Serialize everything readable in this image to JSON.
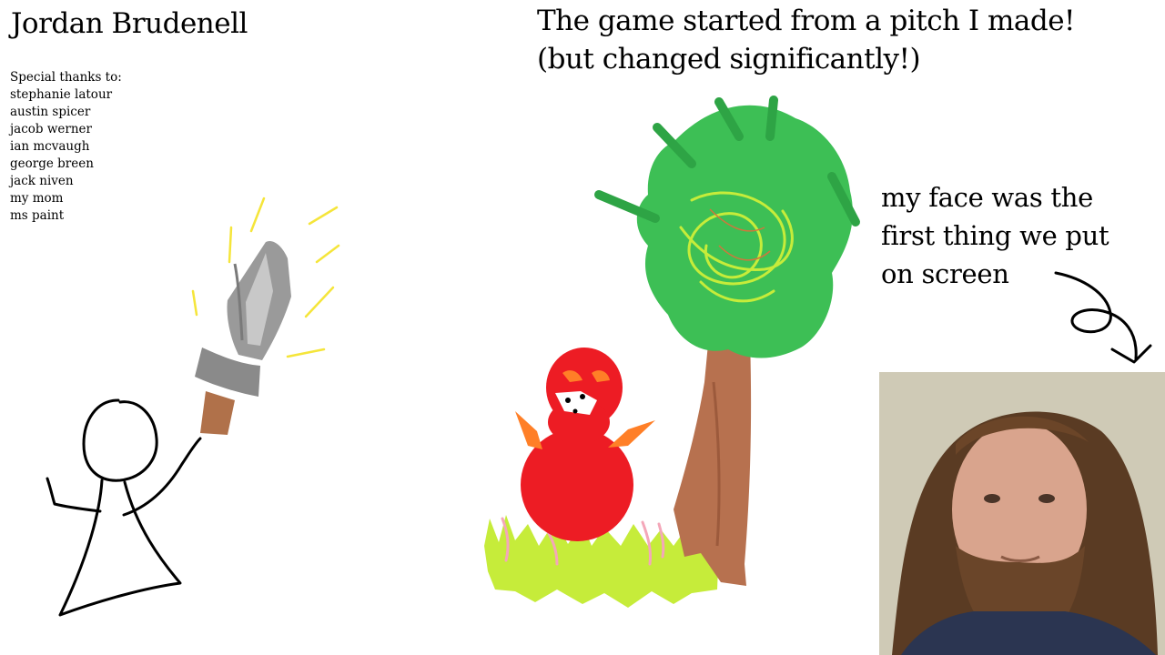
{
  "author": {
    "name": "Jordan Brudenell"
  },
  "thanks": {
    "heading": "Special thanks to:",
    "names": [
      "stephanie latour",
      "austin spicer",
      "jacob werner",
      "ian mcvaugh",
      "george breen",
      "jack niven",
      "my mom",
      "ms paint"
    ]
  },
  "pitch": {
    "line1": "The game started from a pitch I made!",
    "line2": "(but changed significantly!)"
  },
  "face_note": {
    "line1": "my face was the",
    "line2": "first thing we put",
    "line3": "on screen"
  },
  "drawings": [
    "stick-figure-with-sword",
    "red-creature-in-grass",
    "tree",
    "curly-arrow",
    "portrait-photo"
  ]
}
